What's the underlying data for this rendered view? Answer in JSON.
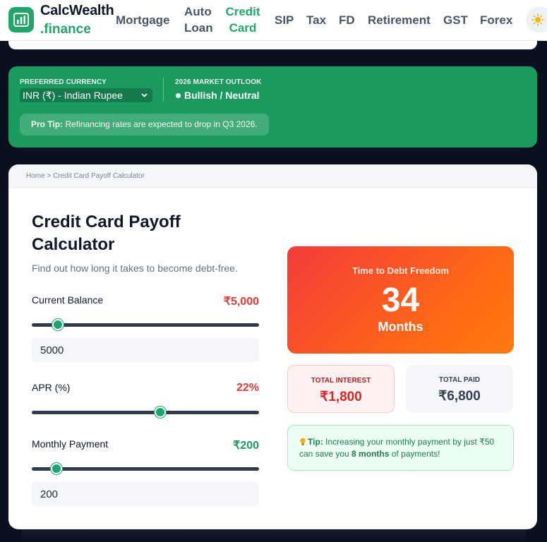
{
  "brand": {
    "name_line1": "CalcWealth",
    "name_line2": ".finance",
    "accent": "#22a66a"
  },
  "nav": {
    "items": [
      {
        "label": "Mortgage"
      },
      {
        "label": "Auto\nLoan"
      },
      {
        "label": "Credit\nCard",
        "active": true
      },
      {
        "label": "SIP"
      },
      {
        "label": "Tax"
      },
      {
        "label": "FD"
      },
      {
        "label": "Retirement"
      },
      {
        "label": "GST"
      },
      {
        "label": "Forex"
      }
    ],
    "theme_icon": "sun-icon"
  },
  "banner": {
    "currency_label": "Preferred Currency",
    "currency_value": "INR (₹) - Indian Rupee",
    "outlook_label": "2026 Market Outlook",
    "outlook_value": "Bullish / Neutral",
    "tip_bold": "Pro Tip:",
    "tip_text": " Refinancing rates are expected to drop in Q3 2026."
  },
  "breadcrumb": "Home > Credit Card Payoff Calculator",
  "calculator": {
    "title": "Credit Card Payoff Calculator",
    "subtitle": "Find out how long it takes to become debt-free.",
    "balance": {
      "label": "Current Balance",
      "display": "₹5,000",
      "input": "5000",
      "slider_fraction": 0.115
    },
    "apr": {
      "label": "APR (%)",
      "display": "22%",
      "slider_fraction": 0.565
    },
    "payment": {
      "label": "Monthly Payment",
      "display": "₹200",
      "input": "200",
      "slider_fraction": 0.11
    }
  },
  "results": {
    "hero_label": "Time to Debt Freedom",
    "hero_value": "34",
    "hero_unit": "Months",
    "interest_label": "Total Interest",
    "interest_value": "₹1,800",
    "paid_label": "Total Paid",
    "paid_value": "₹6,800",
    "tip_bold": "Tip:",
    "tip_text1": " Increasing your monthly payment by just ₹50 can save you ",
    "tip_bold2": "8 months",
    "tip_text2": " of payments!"
  }
}
